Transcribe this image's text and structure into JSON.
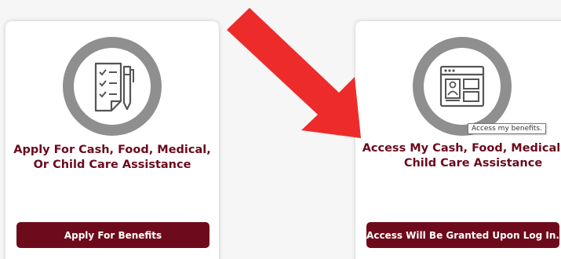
{
  "cards": [
    {
      "icon": "checklist-pen-icon",
      "title": "Apply For Cash, Food, Medical, Or Child Care Assistance",
      "button_label": "Apply For Benefits"
    },
    {
      "icon": "web-profile-window-icon",
      "title": "Access My Cash, Food, Medical, Or Child Care Assistance",
      "button_label": "Access Will Be Granted Upon Log In."
    }
  ],
  "tooltip": "Access my benefits.",
  "colors": {
    "brand_maroon": "#6d0b1c",
    "title_maroon": "#6b0a1e",
    "ring_gray": "#8f8f8f",
    "annotation_red": "#ee2b2b"
  }
}
